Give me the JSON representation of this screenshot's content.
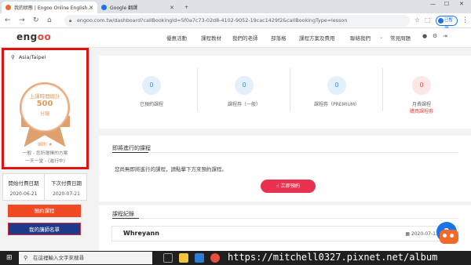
{
  "browser": {
    "tabs": [
      {
        "title": "我的狀態 | Engoo Online English...",
        "active": true,
        "favicon_color": "#f26a2a"
      },
      {
        "title": "Google 翻譯",
        "active": false,
        "favicon_color": "#1a73e8"
      }
    ],
    "new_tab": "+",
    "url": "engoo.com.tw/dashboard?callBookingId=5f0a7c73-02d8-4102-9052-19cac1429f2&callBookingType=lesson",
    "profile_label": "已暫停"
  },
  "header": {
    "logo": [
      "eng",
      "oo"
    ],
    "nav": [
      "優惠活動",
      "課程教材",
      "我們的老師",
      "部落格",
      "課程方案及費用",
      "聯絡我們",
      "常見問題"
    ]
  },
  "sidebar": {
    "timezone": "Asia/Taipei",
    "badge": {
      "title": "上課時間總計",
      "value": "500",
      "unit": "分鐘"
    },
    "rule_link": "細則 ★",
    "plan_line1": "一般 - 您所選擇的方案",
    "plan_line2": "一天一堂 - (進行中)",
    "dates": {
      "start_label": "開始付費日期",
      "start_value": "2020-06-21",
      "next_label": "下次付費日期",
      "next_value": "2020-07-21"
    },
    "book_button": "預約課程",
    "favorites_button": "我的講師名單"
  },
  "stats": [
    {
      "value": "0",
      "label": "已預約課程",
      "sub": ""
    },
    {
      "value": "0",
      "label": "課程券（一般）",
      "sub": ""
    },
    {
      "value": "0",
      "label": "課程券（PREMIUM）",
      "sub": ""
    },
    {
      "value": "0",
      "label": "月費課程",
      "sub": "購買課程券"
    }
  ],
  "upcoming": {
    "title": "即將進行的課程",
    "empty_text": "您尚無即將進行的課程，請點擊下方來預約課程。",
    "book_now": "立即預約"
  },
  "records": {
    "title": "課程紀錄",
    "items": [
      {
        "name": "Whreyann",
        "date": "2020-07-13 10:30"
      }
    ]
  },
  "taskbar": {
    "search_placeholder": "在這裡輸入文字來搜尋",
    "watermark": "https://mitchell0327.pixnet.net/album"
  }
}
